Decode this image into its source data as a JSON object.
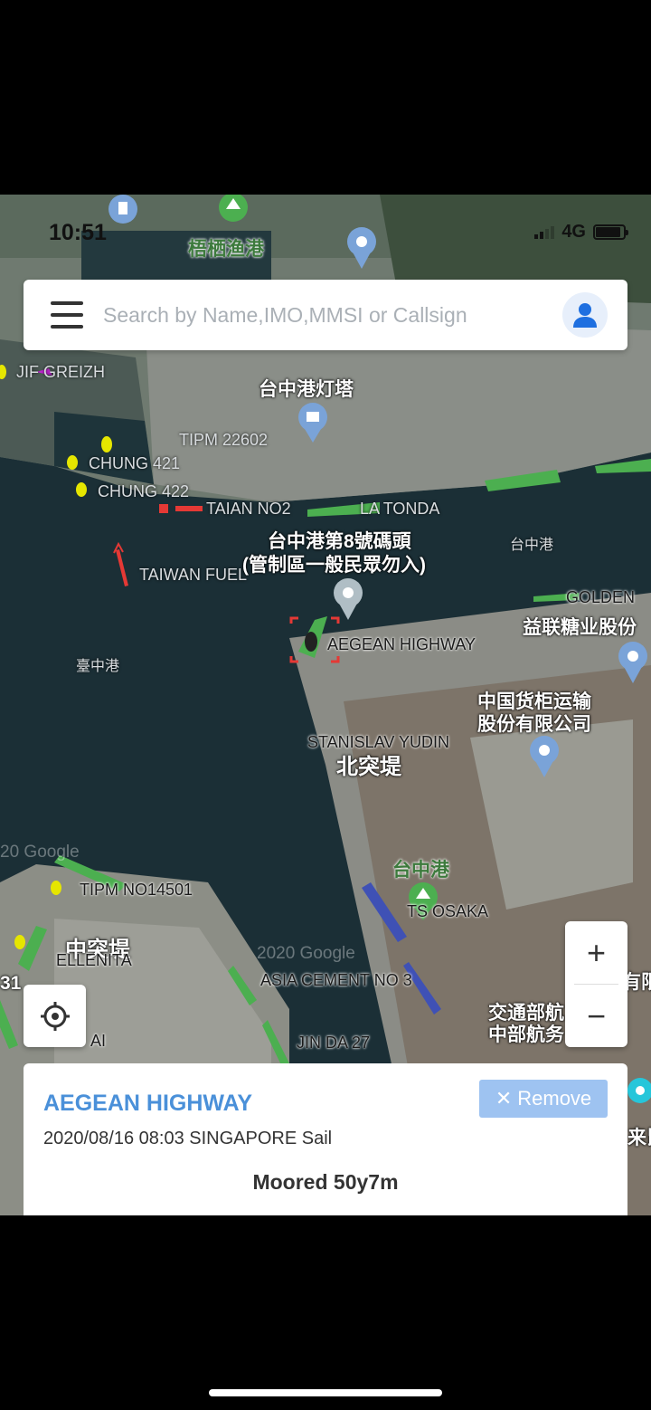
{
  "status_bar": {
    "time": "10:51",
    "network": "4G"
  },
  "search": {
    "placeholder": "Search by Name,IMO,MMSI or Callsign"
  },
  "map": {
    "place_labels": {
      "fishing_port": "梧栖渔港",
      "lighthouse": "台中港灯塔",
      "wharf_line1": "台中港第8號碼頭",
      "wharf_line2": "(管制區一般民眾勿入)",
      "port_en": "台中港",
      "taichung_port_water": "臺中港",
      "yilian_sugar": "益联糖业股份",
      "container_line1": "中国货柜运输",
      "container_line2": "股份有限公司",
      "north_breakwater": "北突堤",
      "taichung_port": "台中港",
      "middle_breakwater": "中突堤",
      "transport_line1": "交通部航",
      "transport_line2": "中部航务",
      "right_edge_1": "有限",
      "right_edge_2": "来昆",
      "left_edge_1": "31",
      "watermark_1": "20 Google",
      "watermark_2": "2020 Google"
    },
    "vessel_labels": {
      "jif": "JIF GREIZH",
      "tipm22602": "TIPM 22602",
      "chung421": "CHUNG 421",
      "chung422": "CHUNG 422",
      "taian": "TAIAN NO2",
      "la_tonda": "LA TONDA",
      "taiwan_fuel": "TAIWAN FUEL",
      "golden": "GOLDEN",
      "aegean": "AEGEAN HIGHWAY",
      "stanislav": "STANISLAV YUDIN",
      "tipm14501": "TIPM NO14501",
      "ellenita": "ELLENITA",
      "ts_osaka": "TS OSAKA",
      "asia_cement": "ASIA CEMENT NO 3",
      "jin_da": "JIN DA 27",
      "ai": "AI"
    }
  },
  "controls": {
    "zoom_in": "+",
    "zoom_out": "−"
  },
  "vessel_card": {
    "name": "AEGEAN HIGHWAY",
    "remove_label": "Remove",
    "remove_icon": "✕",
    "detail": "2020/08/16 08:03 SINGAPORE Sail",
    "status": "Moored 50y7m"
  }
}
